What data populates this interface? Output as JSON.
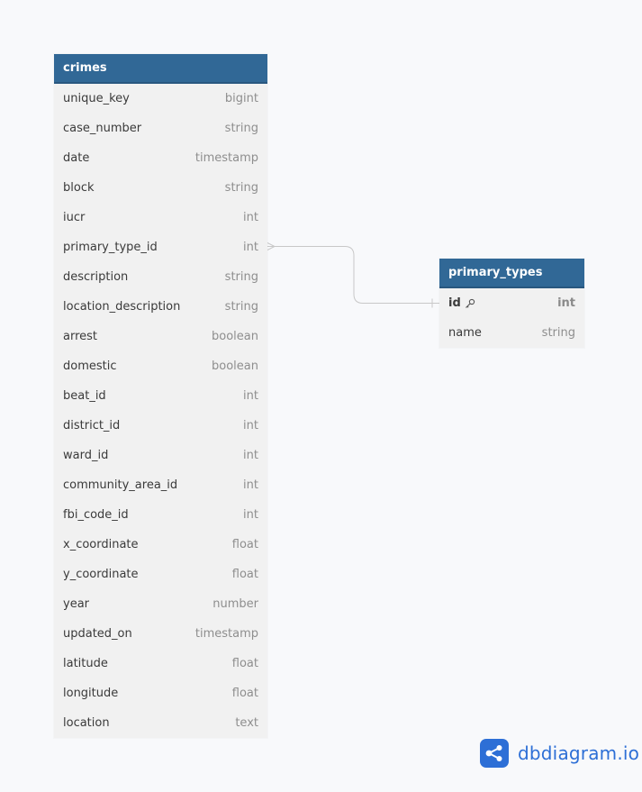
{
  "tables": {
    "crimes": {
      "name": "crimes",
      "fields": [
        {
          "name": "unique_key",
          "type": "bigint"
        },
        {
          "name": "case_number",
          "type": "string"
        },
        {
          "name": "date",
          "type": "timestamp"
        },
        {
          "name": "block",
          "type": "string"
        },
        {
          "name": "iucr",
          "type": "int"
        },
        {
          "name": "primary_type_id",
          "type": "int"
        },
        {
          "name": "description",
          "type": "string"
        },
        {
          "name": "location_description",
          "type": "string"
        },
        {
          "name": "arrest",
          "type": "boolean"
        },
        {
          "name": "domestic",
          "type": "boolean"
        },
        {
          "name": "beat_id",
          "type": "int"
        },
        {
          "name": "district_id",
          "type": "int"
        },
        {
          "name": "ward_id",
          "type": "int"
        },
        {
          "name": "community_area_id",
          "type": "int"
        },
        {
          "name": "fbi_code_id",
          "type": "int"
        },
        {
          "name": "x_coordinate",
          "type": "float"
        },
        {
          "name": "y_coordinate",
          "type": "float"
        },
        {
          "name": "year",
          "type": "number"
        },
        {
          "name": "updated_on",
          "type": "timestamp"
        },
        {
          "name": "latitude",
          "type": "float"
        },
        {
          "name": "longitude",
          "type": "float"
        },
        {
          "name": "location",
          "type": "text"
        }
      ]
    },
    "primary_types": {
      "name": "primary_types",
      "fields": [
        {
          "name": "id",
          "type": "int",
          "primary_key": true
        },
        {
          "name": "name",
          "type": "string"
        }
      ]
    }
  },
  "relationship": {
    "from": "crimes.primary_type_id",
    "to": "primary_types.id",
    "cardinality": "many-to-one"
  },
  "brand": {
    "logo_text": "dbdiagram.io",
    "color": "#2d6fd6"
  },
  "colors": {
    "header": "#316896",
    "body": "#f1f1f1",
    "background": "#f8f9fb",
    "connector": "#c8c8c8"
  }
}
